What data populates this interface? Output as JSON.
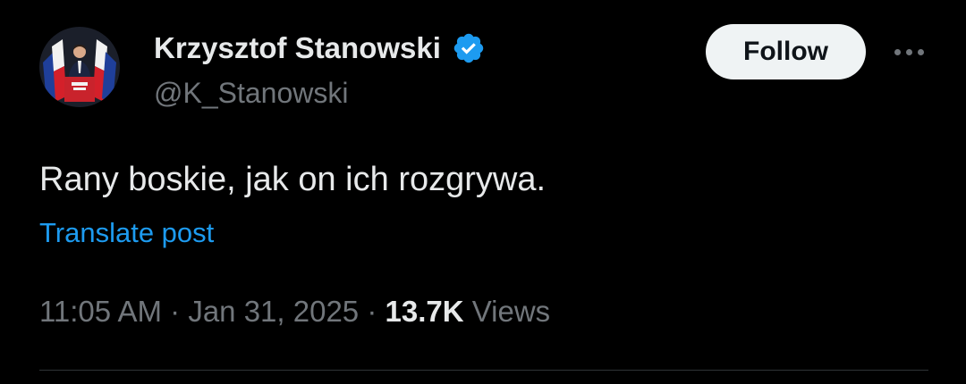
{
  "author": {
    "display_name": "Krzysztof Stanowski",
    "handle": "@K_Stanowski",
    "verified": true
  },
  "actions": {
    "follow_label": "Follow",
    "more_icon": "more-horizontal-icon"
  },
  "post": {
    "text": "Rany boskie, jak on ich rozgrywa.",
    "translate_label": "Translate post",
    "time": "11:05 AM",
    "date": "Jan 31, 2025",
    "separator": "·",
    "views_count": "13.7K",
    "views_label": "Views"
  },
  "colors": {
    "background": "#000000",
    "text_primary": "#e7e9ea",
    "text_secondary": "#71767b",
    "link": "#1d9bf0",
    "verified_badge": "#1d9bf0",
    "follow_button_bg": "#eff3f4",
    "divider": "#2f3336"
  }
}
